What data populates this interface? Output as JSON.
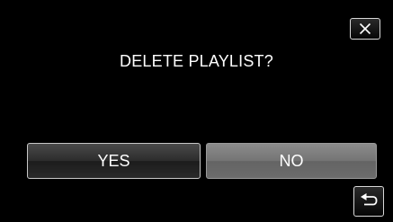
{
  "dialog": {
    "prompt": "DELETE PLAYLIST?",
    "yes_label": "YES",
    "no_label": "NO"
  },
  "icons": {
    "close": "close-icon",
    "back": "return-arrow-icon"
  },
  "colors": {
    "background": "#000000",
    "text": "#ffffff",
    "yes_button": "#333333",
    "no_button": "#747474",
    "border": "#d8d8d8"
  }
}
